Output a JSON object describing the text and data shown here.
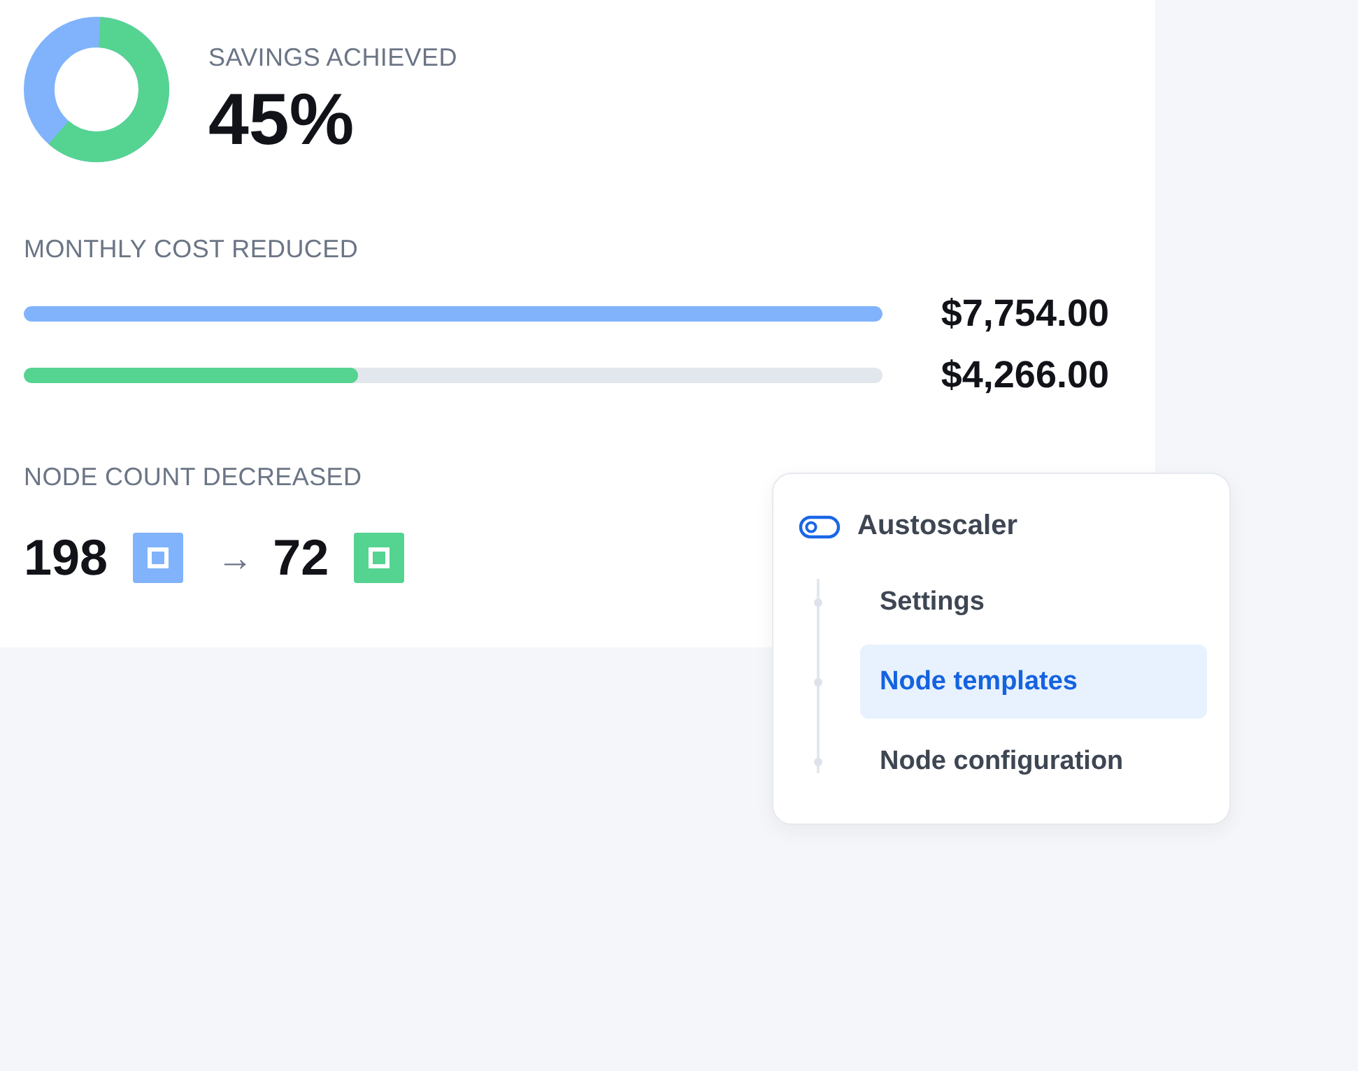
{
  "savings": {
    "label": "SAVINGS ACHIEVED",
    "value": "45%"
  },
  "monthly_cost": {
    "label": "MONTHLY COST REDUCED",
    "bars": [
      {
        "level": 1,
        "color": "#80b3fb",
        "reading": "$7,754.00"
      },
      {
        "level": 0.39,
        "color": "#55d390",
        "reading": "$4,266.00"
      }
    ]
  },
  "node_count": {
    "label": "NODE COUNT DECREASED",
    "arrow": "→",
    "counts": [
      {
        "value": "198",
        "color": "#80b3fb"
      },
      {
        "value": "72",
        "color": "#55d390"
      }
    ]
  },
  "menu": {
    "title": "Austoscaler",
    "items": [
      {
        "label": "Settings",
        "selected": false
      },
      {
        "label": "Node templates",
        "selected": true
      },
      {
        "label": "Node configuration",
        "selected": false
      }
    ]
  }
}
